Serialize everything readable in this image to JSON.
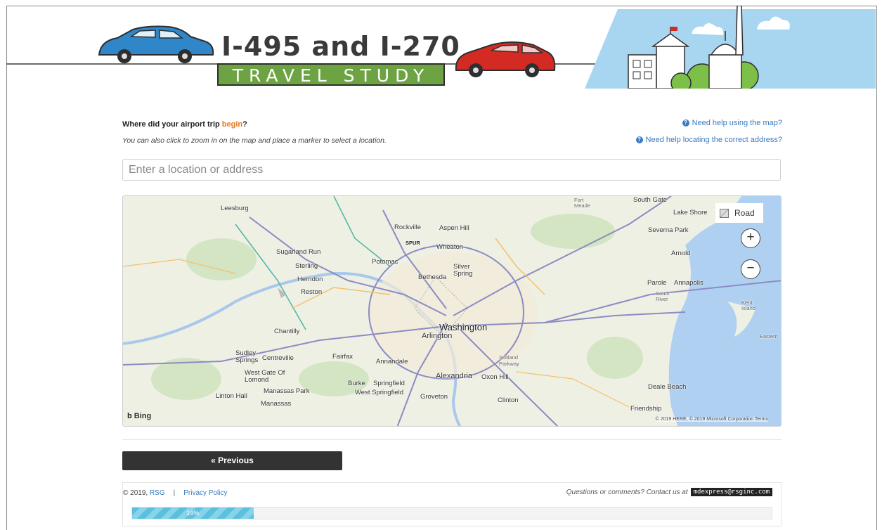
{
  "header": {
    "title": "I-495 and I-270",
    "subtitle": "TRAVEL STUDY"
  },
  "question": {
    "prefix": "Where did your airport trip ",
    "highlight": "begin",
    "suffix": "?"
  },
  "instruction": "You can also click to zoom in on the map and place a marker to select a location.",
  "help_links": {
    "map_help": "Need help using the map?",
    "address_help": "Need help locating the correct address?"
  },
  "search": {
    "placeholder": "Enter a location or address"
  },
  "map": {
    "style_button": "Road",
    "zoom_in": "+",
    "zoom_out": "−",
    "attribution": "Bing",
    "copyright": "© 2019 HERE, © 2019 Microsoft Corporation  Terms",
    "labels": {
      "washington": "Washington",
      "arlington": "Arlington",
      "alexandria": "Alexandria",
      "bethesda": "Bethesda",
      "silver_spring": "Silver\nSpring",
      "rockville": "Rockville",
      "aspen_hill": "Aspen Hill",
      "wheaton": "Wheaton",
      "potomac": "Potomac",
      "leesburg": "Leesburg",
      "sugarland_run": "Sugarland Run",
      "sterling": "Sterling",
      "herndon": "Herndon",
      "reston": "Reston",
      "chantilly": "Chantilly",
      "fairfax": "Fairfax",
      "annandale": "Annandale",
      "centreville": "Centreville",
      "sudley_springs": "Sudley Springs",
      "west_gate_of_lomond": "West Gate Of Lomond",
      "manassas_park": "Manassas Park",
      "manassas": "Manassas",
      "linton_hall": "Linton Hall",
      "burke": "Burke",
      "springfield": "Springfield",
      "west_springfield": "West Springfield",
      "groveton": "Groveton",
      "oxon_hill": "Oxon Hill",
      "clinton": "Clinton",
      "suitland_parkway": "Suitland Parkway",
      "deale_beach": "Deale Beach",
      "friendship": "Friendship",
      "annapolis": "Annapolis",
      "parole": "Parole",
      "arnold": "Arnold",
      "severna_park": "Severna Park",
      "lake_shore": "Lake Shore",
      "south_gate": "South Gate",
      "fort_meade": "Fort Meade",
      "south_river": "South River",
      "kent_island": "Kent Island",
      "eastern": "Eastern",
      "spur": "SPUR"
    }
  },
  "navigation": {
    "previous": "« Previous"
  },
  "footer": {
    "copyright": "© 2019, ",
    "rsg": "RSG",
    "privacy": "Privacy Policy",
    "contact": "Questions or comments? Contact us at",
    "email": "mdexpress@rsginc.com"
  },
  "progress": {
    "percent": 19,
    "label": "19%"
  },
  "colors": {
    "accent_link": "#3a7bbf",
    "highlight": "#e07a1f",
    "title_green": "#6ea343",
    "progress": "#5bc0de"
  }
}
